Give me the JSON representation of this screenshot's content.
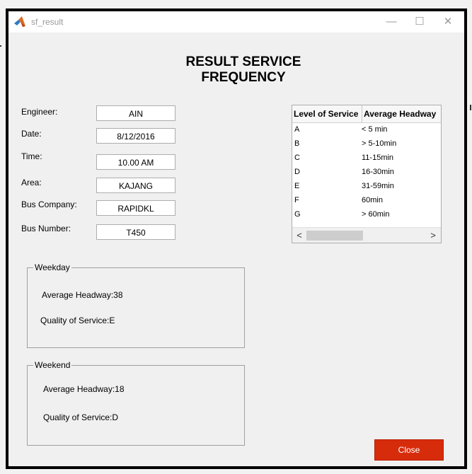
{
  "window": {
    "title": "sf_result",
    "minimize_glyph": "—",
    "maximize_glyph": "☐",
    "close_glyph": "✕"
  },
  "heading": {
    "line1": "RESULT SERVICE",
    "line2": "FREQUENCY"
  },
  "fields": [
    {
      "label": "Engineer:",
      "value": "AIN"
    },
    {
      "label": "Date:",
      "value": "8/12/2016"
    },
    {
      "label": "Time:",
      "value": "10.00 AM"
    },
    {
      "label": "Area:",
      "value": "KAJANG"
    },
    {
      "label": "Bus Company:",
      "value": "RAPIDKL"
    },
    {
      "label": "Bus Number:",
      "value": "T450"
    }
  ],
  "table": {
    "columns": [
      "Level of Service",
      "Average Headway"
    ],
    "rows": [
      [
        "A",
        "< 5 min"
      ],
      [
        "B",
        "> 5-10min"
      ],
      [
        "C",
        "11-15min"
      ],
      [
        "D",
        "16-30min"
      ],
      [
        "E",
        "31-59min"
      ],
      [
        "F",
        "60min"
      ],
      [
        "G",
        "> 60min"
      ]
    ],
    "scroll_left": "<",
    "scroll_right": ">"
  },
  "weekday": {
    "title": "Weekday",
    "avg_headway": "Average Headway:38",
    "quality": "Quality of Service:E"
  },
  "weekend": {
    "title": "Weekend",
    "avg_headway": "Average Headway:18",
    "quality": "Quality of Service:D"
  },
  "close_button": "Close",
  "colors": {
    "close_button_bg": "#d72c0c",
    "window_frame": "#000000"
  },
  "icons": {
    "app": "matlab-logo-icon"
  }
}
